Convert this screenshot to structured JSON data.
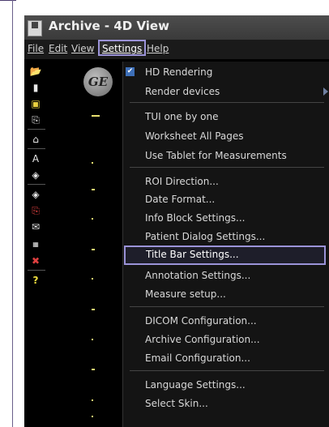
{
  "window": {
    "title": "Archive - 4D View"
  },
  "menubar": {
    "items": [
      {
        "label": "File"
      },
      {
        "label": "Edit"
      },
      {
        "label": "View"
      },
      {
        "label": "Settings"
      },
      {
        "label": "Help"
      }
    ]
  },
  "toolbar": {
    "icons": [
      "open-folder-icon",
      "new-file-icon",
      "save-icon",
      "print-icon",
      "home-icon",
      "text-icon",
      "arrow-icon",
      "arrow-left-icon",
      "printer-red-icon",
      "email-icon",
      "image-icon",
      "delete-icon",
      "help-icon"
    ],
    "help_label": "?",
    "text_label": "A"
  },
  "viewport": {
    "logo": "GE"
  },
  "settings_menu": {
    "items": [
      {
        "label": "HD Rendering",
        "checked": true
      },
      {
        "label": "Render devices",
        "submenu": true
      },
      {
        "label": "TUI one by one"
      },
      {
        "label": "Worksheet All Pages"
      },
      {
        "label": "Use Tablet for Measurements"
      },
      {
        "label": "ROI Direction..."
      },
      {
        "label": "Date Format..."
      },
      {
        "label": "Info Block Settings..."
      },
      {
        "label": "Patient Dialog Settings..."
      },
      {
        "label": "Title Bar Settings...",
        "highlighted": true
      },
      {
        "label": "Annotation Settings..."
      },
      {
        "label": "Measure setup..."
      },
      {
        "label": "DICOM Configuration..."
      },
      {
        "label": "Archive Configuration..."
      },
      {
        "label": "Email Configuration..."
      },
      {
        "label": "Language Settings..."
      },
      {
        "label": "Select Skin..."
      }
    ]
  },
  "colors": {
    "highlight_border": "#9b93d8",
    "menu_bg": "#141414",
    "check_bg": "#3d6fb8"
  }
}
